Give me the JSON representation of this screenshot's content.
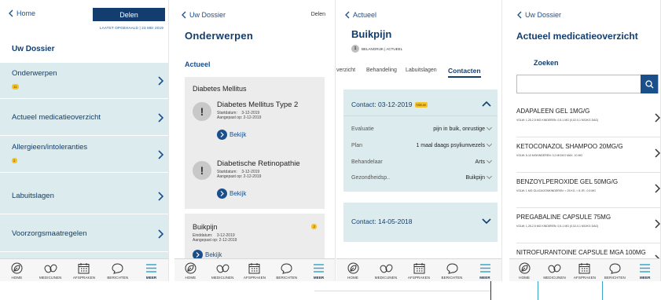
{
  "tabbar": {
    "items": [
      {
        "label": "HOME",
        "icon": "leaf-icon"
      },
      {
        "label": "MEDICIJNEN",
        "icon": "pills-icon"
      },
      {
        "label": "AFSPRAKEN",
        "icon": "calendar-icon"
      },
      {
        "label": "BERICHTEN",
        "icon": "chat-icon"
      },
      {
        "label": "MEER",
        "icon": "menu-icon"
      }
    ]
  },
  "screen1": {
    "back_label": "Home",
    "share_button": "Delen",
    "last_fetched": "LAATST OPGEHAALD | 23 MEI 2019",
    "title": "Uw Dossier",
    "items": [
      {
        "label": "Onderwerpen",
        "badge": "11"
      },
      {
        "label": "Actueel medicatieoverzicht",
        "badge": ""
      },
      {
        "label": "Allergieen/intoleranties",
        "badge": "2"
      },
      {
        "label": "Labuitslagen",
        "badge": ""
      },
      {
        "label": "Voorzorgsmaatregelen",
        "badge": ""
      }
    ]
  },
  "screen2": {
    "back_label": "Uw Dossier",
    "share_label": "Delen",
    "title": "Onderwerpen",
    "section": "Actueel",
    "group_title": "Diabetes Mellitus",
    "diagnoses": [
      {
        "name": "Diabetes Mellitus Type 2",
        "details": "Startdatum:    3-12-2019\nAangepast op: 2-12-2019",
        "view": "Bekijk"
      },
      {
        "name": "Diabetische Retinopathie",
        "details": "Startdatum:    3-12-2019\nAangepast op: 2-12-2019",
        "view": "Bekijk"
      }
    ],
    "card2": {
      "title": "Buikpijn",
      "badge": "2",
      "details": "Einddatum:    3-12-2019\nAangepast op: 2-12-2019",
      "view": "Bekijk"
    }
  },
  "screen3": {
    "back_label": "Actueel",
    "title": "Buikpijn",
    "level": "1",
    "meta": "BELANGRIJK  |  ACTUEEL",
    "tabs": [
      "verzicht",
      "Behandeling",
      "Labuitslagen",
      "Contacten"
    ],
    "contact1": {
      "title": "Contact: 03-12-2019",
      "badge": "Nieuw",
      "rows": [
        {
          "key": "Evaluatie",
          "value": "pijn in buik, onrustige"
        },
        {
          "key": "Plan",
          "value": "1 maal daags psyliumvezels"
        },
        {
          "key": "Behandelaar",
          "value": "Arts"
        },
        {
          "key": "Gezondheidsp..",
          "value": "Buikpijn"
        }
      ]
    },
    "contact2": {
      "title": "Contact: 14-05-2018"
    }
  },
  "screen4": {
    "back_label": "Uw Dossier",
    "title": "Actueel medicatieoverzicht",
    "search_label": "Zoeken",
    "search_value": "",
    "medications": [
      {
        "name": "ADAPALEEN GEL 1MG/G",
        "dose": "VOLW: 1,25-2,5 MG KINDEREN: 0,5-1 MG (0,02-0,1 MG/KG DAG)"
      },
      {
        "name": "KETOCONAZOL SHAMPOO 20MG/G",
        "dose": "VOLW: 5-10 MGKINDEREN: 0,2 MG/KG MAX. 10 MG"
      },
      {
        "name": "BENZOYLPEROXIDE GEL  50MG/G",
        "dose": "VOLW: 1 MG GLUCAGONKINDEREN: < 25 KG, < 8 JR.: 0,5 MG"
      },
      {
        "name": "PREGABALINE CAPSULE  75MG",
        "dose": "VOLW: 1,25-2,5 MG KINDEREN: 0,5-1 MG (0,02-0,1 MG/KG DAG)"
      },
      {
        "name": "NITROFURANTOINE CAPSULE MGA 100MG",
        "dose": ""
      }
    ]
  },
  "colors": {
    "primary": "#123d6e",
    "accent": "#1b4f8a",
    "highlight": "#dcecee",
    "badge": "#f6c22a"
  }
}
